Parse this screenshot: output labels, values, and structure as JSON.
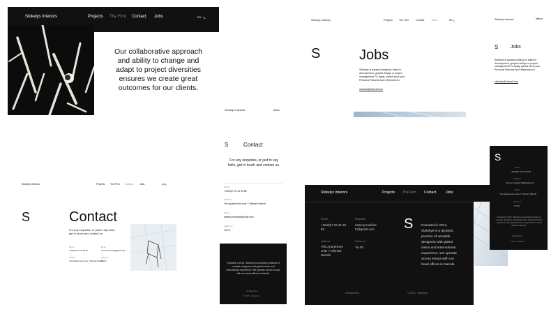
{
  "brand": "Stokelys Interiors",
  "nav": [
    "Projects",
    "The Firm",
    "Contact",
    "Jobs"
  ],
  "menu_label": "Menu",
  "lang_options": [
    "EN",
    "ع"
  ],
  "logo_letter": "S",
  "firm": {
    "statement": "Our collaborative approach and ability to change and adapt to project diversities ensures we create great outcomes for our clients."
  },
  "jobs": {
    "heading": "Jobs",
    "body": "Stokelys is always looking for talent in development, graphic design or project management! To apply, please send your Personal Resume and references to:",
    "email": "stokelys@hotmail.com"
  },
  "contact": {
    "heading": "Contact",
    "intro": "For any enquiries, or just to say hello, get in touch and contact us.",
    "fields": [
      {
        "label": "Phone",
        "value": "+254(0)7 29 41 93 55"
      },
      {
        "label": "Address",
        "value": "Yelu Apartments suite 7 Kilimani Nairobi"
      },
      {
        "label": "Email",
        "value": "sammy.mushira@gmail.com"
      },
      {
        "label": "Follow us",
        "value": "Tw  Fb"
      }
    ]
  },
  "footer": {
    "about": "Founded in 2014, Stokelys is a dynamic practice of versatile designers with global vision and international experience. We operate across Kenya with our head offices in Nairobi.",
    "phone_label": "Phone",
    "phone": "+254(0)7 29 41 93 55",
    "enquiries_label": "Enquiries",
    "enquiries": "sammy.mushira hi@gmail.com",
    "address_label": "Address",
    "address": "Yelu Apartments suite 7 Kilimani Nairobi",
    "follow_label": "Follow us",
    "social": "Tw  Fb",
    "designed_by": "Designed by",
    "copyright": "© 2015 · Stokelys"
  },
  "colors": {
    "dark": "#111111",
    "muted": "#888888",
    "accent": "#3a5f7a"
  }
}
